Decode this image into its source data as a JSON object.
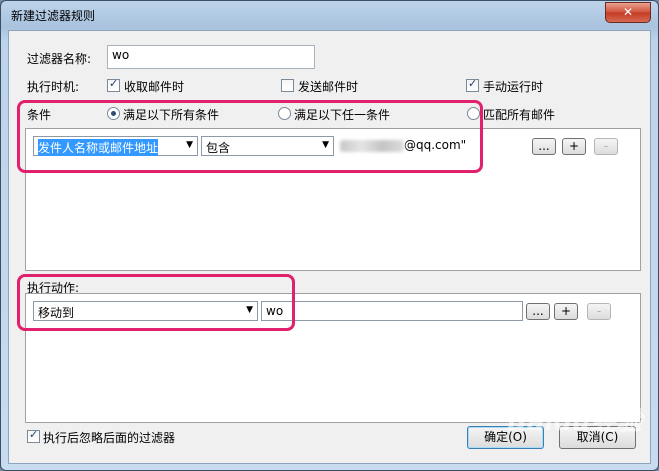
{
  "window": {
    "title": "新建过滤器规则",
    "close_label": "✕"
  },
  "filter_name": {
    "label": "过滤器名称:",
    "value": "wo"
  },
  "run_time": {
    "label": "执行时机:",
    "options": [
      {
        "label": "收取邮件时",
        "checked": true
      },
      {
        "label": "发送邮件时",
        "checked": false
      },
      {
        "label": "手动运行时",
        "checked": true
      }
    ]
  },
  "conditions": {
    "label": "条件",
    "modes": [
      {
        "label": "满足以下所有条件",
        "selected": true
      },
      {
        "label": "满足以下任一条件",
        "selected": false
      },
      {
        "label": "匹配所有邮件",
        "selected": false
      }
    ],
    "row": {
      "field": "发件人名称或邮件地址",
      "operator": "包含",
      "value_suffix": "@qq.com\"",
      "more": "...",
      "add": "+",
      "remove": "-"
    }
  },
  "actions": {
    "label": "执行动作:",
    "row": {
      "action": "移动到",
      "target": "wo",
      "more": "...",
      "add": "+",
      "remove": "-"
    }
  },
  "skip_later": {
    "label": "执行后忽略后面的过滤器",
    "checked": true
  },
  "buttons": {
    "ok": "确定(O)",
    "cancel": "取消(C)"
  },
  "watermark": "Baidu经验",
  "colors": {
    "highlight": "#e0226e",
    "selection": "#3399ff"
  }
}
